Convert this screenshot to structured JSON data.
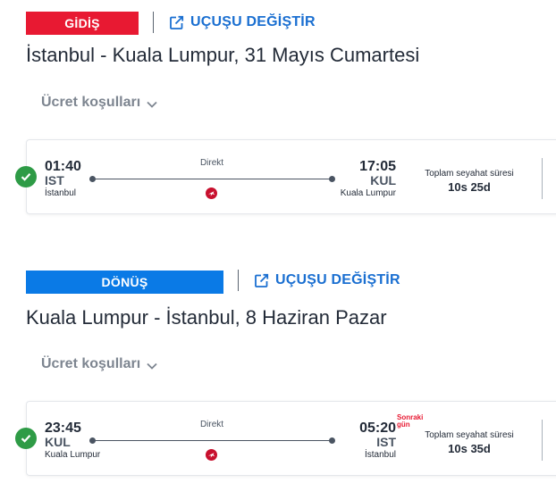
{
  "outbound": {
    "badge": "GİDİŞ",
    "change_label": "UÇUŞU DEĞİŞTİR",
    "route_title": "İstanbul - Kuala Lumpur, 31 Mayıs Cumartesi",
    "fare_conditions": "Ücret koşulları",
    "departure": {
      "time": "01:40",
      "code": "IST",
      "city": "İstanbul"
    },
    "arrival": {
      "time": "17:05",
      "code": "KUL",
      "city": "Kuala Lumpur"
    },
    "stop_type": "Direkt",
    "duration_label": "Toplam seyahat süresi",
    "duration": "10s 25d"
  },
  "return": {
    "badge": "DÖNÜŞ",
    "change_label": "UÇUŞU DEĞİŞTİR",
    "route_title": "Kuala Lumpur - İstanbul, 8 Haziran Pazar",
    "fare_conditions": "Ücret koşulları",
    "departure": {
      "time": "23:45",
      "code": "KUL",
      "city": "Kuala Lumpur"
    },
    "arrival": {
      "time": "05:20",
      "code": "IST",
      "city": "İstanbul"
    },
    "next_day_line1": "Sonraki",
    "next_day_line2": "gün",
    "stop_type": "Direkt",
    "duration_label": "Toplam seyahat süresi",
    "duration": "10s 35d"
  },
  "colors": {
    "outbound_badge": "#e81932",
    "return_badge": "#0a7ae6",
    "link": "#1a6fd1",
    "check": "#2e9b46"
  },
  "icons": {
    "change": "edit-external-icon",
    "fare_toggle": "chevron-down-icon",
    "selected": "check-circle-icon",
    "airline": "turkish-airlines-logo-icon"
  }
}
